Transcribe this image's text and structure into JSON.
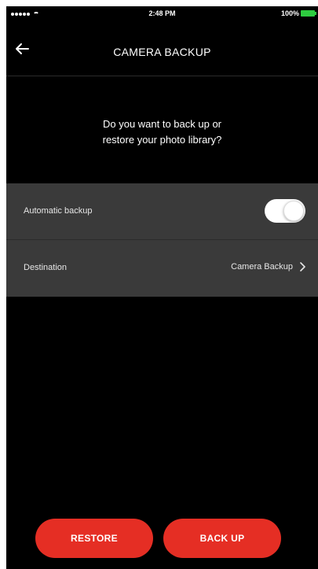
{
  "status_bar": {
    "time": "2:48 PM",
    "battery_percent": "100%",
    "battery_color": "#2ecc40",
    "signal_dots": 5
  },
  "nav": {
    "back_icon": "arrow-left-icon",
    "title": "CAMERA BACKUP"
  },
  "prompt": {
    "line1": "Do you want to back up or",
    "line2": "restore your photo library?"
  },
  "settings": {
    "automatic_backup": {
      "label": "Automatic backup",
      "enabled": false
    },
    "destination": {
      "label": "Destination",
      "value": "Camera Backup",
      "icon": "chevron-right-icon"
    }
  },
  "actions": {
    "restore_label": "RESTORE",
    "backup_label": "BACK UP",
    "accent_color": "#e52e24"
  }
}
